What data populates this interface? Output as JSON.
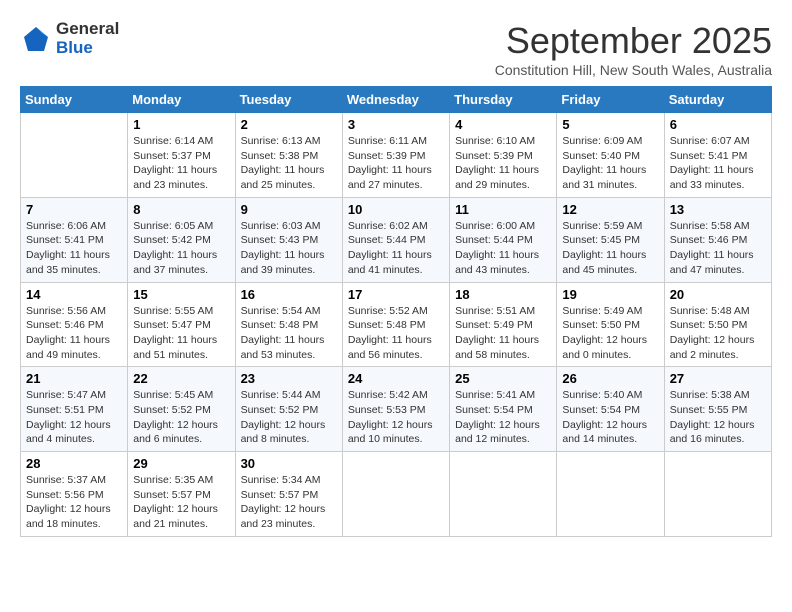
{
  "logo": {
    "general": "General",
    "blue": "Blue"
  },
  "title": "September 2025",
  "location": "Constitution Hill, New South Wales, Australia",
  "weekdays": [
    "Sunday",
    "Monday",
    "Tuesday",
    "Wednesday",
    "Thursday",
    "Friday",
    "Saturday"
  ],
  "weeks": [
    [
      {
        "day": "",
        "info": ""
      },
      {
        "day": "1",
        "info": "Sunrise: 6:14 AM\nSunset: 5:37 PM\nDaylight: 11 hours\nand 23 minutes."
      },
      {
        "day": "2",
        "info": "Sunrise: 6:13 AM\nSunset: 5:38 PM\nDaylight: 11 hours\nand 25 minutes."
      },
      {
        "day": "3",
        "info": "Sunrise: 6:11 AM\nSunset: 5:39 PM\nDaylight: 11 hours\nand 27 minutes."
      },
      {
        "day": "4",
        "info": "Sunrise: 6:10 AM\nSunset: 5:39 PM\nDaylight: 11 hours\nand 29 minutes."
      },
      {
        "day": "5",
        "info": "Sunrise: 6:09 AM\nSunset: 5:40 PM\nDaylight: 11 hours\nand 31 minutes."
      },
      {
        "day": "6",
        "info": "Sunrise: 6:07 AM\nSunset: 5:41 PM\nDaylight: 11 hours\nand 33 minutes."
      }
    ],
    [
      {
        "day": "7",
        "info": "Sunrise: 6:06 AM\nSunset: 5:41 PM\nDaylight: 11 hours\nand 35 minutes."
      },
      {
        "day": "8",
        "info": "Sunrise: 6:05 AM\nSunset: 5:42 PM\nDaylight: 11 hours\nand 37 minutes."
      },
      {
        "day": "9",
        "info": "Sunrise: 6:03 AM\nSunset: 5:43 PM\nDaylight: 11 hours\nand 39 minutes."
      },
      {
        "day": "10",
        "info": "Sunrise: 6:02 AM\nSunset: 5:44 PM\nDaylight: 11 hours\nand 41 minutes."
      },
      {
        "day": "11",
        "info": "Sunrise: 6:00 AM\nSunset: 5:44 PM\nDaylight: 11 hours\nand 43 minutes."
      },
      {
        "day": "12",
        "info": "Sunrise: 5:59 AM\nSunset: 5:45 PM\nDaylight: 11 hours\nand 45 minutes."
      },
      {
        "day": "13",
        "info": "Sunrise: 5:58 AM\nSunset: 5:46 PM\nDaylight: 11 hours\nand 47 minutes."
      }
    ],
    [
      {
        "day": "14",
        "info": "Sunrise: 5:56 AM\nSunset: 5:46 PM\nDaylight: 11 hours\nand 49 minutes."
      },
      {
        "day": "15",
        "info": "Sunrise: 5:55 AM\nSunset: 5:47 PM\nDaylight: 11 hours\nand 51 minutes."
      },
      {
        "day": "16",
        "info": "Sunrise: 5:54 AM\nSunset: 5:48 PM\nDaylight: 11 hours\nand 53 minutes."
      },
      {
        "day": "17",
        "info": "Sunrise: 5:52 AM\nSunset: 5:48 PM\nDaylight: 11 hours\nand 56 minutes."
      },
      {
        "day": "18",
        "info": "Sunrise: 5:51 AM\nSunset: 5:49 PM\nDaylight: 11 hours\nand 58 minutes."
      },
      {
        "day": "19",
        "info": "Sunrise: 5:49 AM\nSunset: 5:50 PM\nDaylight: 12 hours\nand 0 minutes."
      },
      {
        "day": "20",
        "info": "Sunrise: 5:48 AM\nSunset: 5:50 PM\nDaylight: 12 hours\nand 2 minutes."
      }
    ],
    [
      {
        "day": "21",
        "info": "Sunrise: 5:47 AM\nSunset: 5:51 PM\nDaylight: 12 hours\nand 4 minutes."
      },
      {
        "day": "22",
        "info": "Sunrise: 5:45 AM\nSunset: 5:52 PM\nDaylight: 12 hours\nand 6 minutes."
      },
      {
        "day": "23",
        "info": "Sunrise: 5:44 AM\nSunset: 5:52 PM\nDaylight: 12 hours\nand 8 minutes."
      },
      {
        "day": "24",
        "info": "Sunrise: 5:42 AM\nSunset: 5:53 PM\nDaylight: 12 hours\nand 10 minutes."
      },
      {
        "day": "25",
        "info": "Sunrise: 5:41 AM\nSunset: 5:54 PM\nDaylight: 12 hours\nand 12 minutes."
      },
      {
        "day": "26",
        "info": "Sunrise: 5:40 AM\nSunset: 5:54 PM\nDaylight: 12 hours\nand 14 minutes."
      },
      {
        "day": "27",
        "info": "Sunrise: 5:38 AM\nSunset: 5:55 PM\nDaylight: 12 hours\nand 16 minutes."
      }
    ],
    [
      {
        "day": "28",
        "info": "Sunrise: 5:37 AM\nSunset: 5:56 PM\nDaylight: 12 hours\nand 18 minutes."
      },
      {
        "day": "29",
        "info": "Sunrise: 5:35 AM\nSunset: 5:57 PM\nDaylight: 12 hours\nand 21 minutes."
      },
      {
        "day": "30",
        "info": "Sunrise: 5:34 AM\nSunset: 5:57 PM\nDaylight: 12 hours\nand 23 minutes."
      },
      {
        "day": "",
        "info": ""
      },
      {
        "day": "",
        "info": ""
      },
      {
        "day": "",
        "info": ""
      },
      {
        "day": "",
        "info": ""
      }
    ]
  ]
}
